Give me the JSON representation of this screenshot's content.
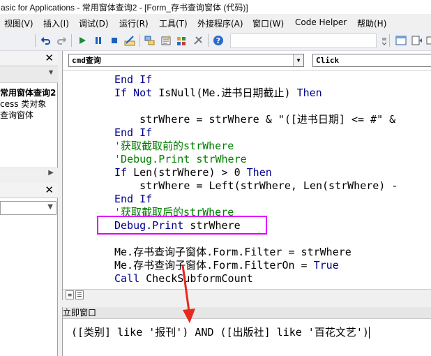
{
  "window": {
    "title": "asic for Applications - 常用窗体查询2 - [Form_存书查询窗体 (代码)]"
  },
  "menu": {
    "items": [
      "视图(V)",
      "插入(I)",
      "调试(D)",
      "运行(R)",
      "工具(T)",
      "外接程序(A)",
      "窗口(W)",
      "Code Helper",
      "帮助(H)"
    ]
  },
  "toolbar": {
    "icons": [
      "undo-icon",
      "redo-icon",
      "run-icon",
      "break-icon",
      "reset-icon",
      "design-mode-icon",
      "project-explorer-icon",
      "properties-icon",
      "object-browser-icon",
      "toolbox-icon",
      "help-icon"
    ]
  },
  "project": {
    "tree": [
      "常用窗体查询2",
      "cess 类对象",
      "查询窗体"
    ]
  },
  "code": {
    "object_combo": "cmd查询",
    "proc_combo": "Click",
    "lines": [
      {
        "parts": [
          {
            "t": "End If",
            "c": "kw"
          }
        ]
      },
      {
        "parts": [
          {
            "t": "If Not",
            "c": "kw"
          },
          {
            "t": " IsNull(Me.进书日期截止) ",
            "c": ""
          },
          {
            "t": "Then",
            "c": "kw"
          }
        ]
      },
      {
        "parts": []
      },
      {
        "parts": [
          {
            "t": "    strWhere = strWhere & \"([进书日期] <= #\" & ",
            "c": ""
          }
        ]
      },
      {
        "parts": [
          {
            "t": "End If",
            "c": "kw"
          }
        ]
      },
      {
        "parts": [
          {
            "t": "'获取截取前的strWhere",
            "c": "cm"
          }
        ]
      },
      {
        "parts": [
          {
            "t": "'Debug.Print strWhere",
            "c": "cm"
          }
        ]
      },
      {
        "parts": [
          {
            "t": "If",
            "c": "kw"
          },
          {
            "t": " Len(strWhere) > 0 ",
            "c": ""
          },
          {
            "t": "Then",
            "c": "kw"
          }
        ]
      },
      {
        "parts": [
          {
            "t": "    strWhere = Left(strWhere, Len(strWhere) - ",
            "c": ""
          }
        ]
      },
      {
        "parts": [
          {
            "t": "End If",
            "c": "kw"
          }
        ]
      },
      {
        "parts": [
          {
            "t": "'获取截取后的strWhere",
            "c": "cm"
          }
        ]
      },
      {
        "parts": [
          {
            "t": "Debug.Print",
            "c": "kw"
          },
          {
            "t": " strWhere",
            "c": ""
          }
        ]
      },
      {
        "parts": []
      },
      {
        "parts": [
          {
            "t": "Me.存书查询子窗体.Form.Filter = strWhere",
            "c": ""
          }
        ]
      },
      {
        "parts": [
          {
            "t": "Me.存书查询子窗体.Form.FilterOn = ",
            "c": ""
          },
          {
            "t": "True",
            "c": "kw"
          }
        ]
      },
      {
        "parts": [
          {
            "t": "Call",
            "c": "kw"
          },
          {
            "t": " CheckSubformCount",
            "c": ""
          }
        ]
      }
    ]
  },
  "immediate": {
    "title": "立即窗口",
    "output": "([类别] like '报刊') AND ([出版社] like '百花文艺')"
  },
  "colors": {
    "annotation_box": "#e100ff",
    "annotation_arrow": "#e8281e",
    "keyword": "#00008b",
    "comment": "#008000"
  }
}
